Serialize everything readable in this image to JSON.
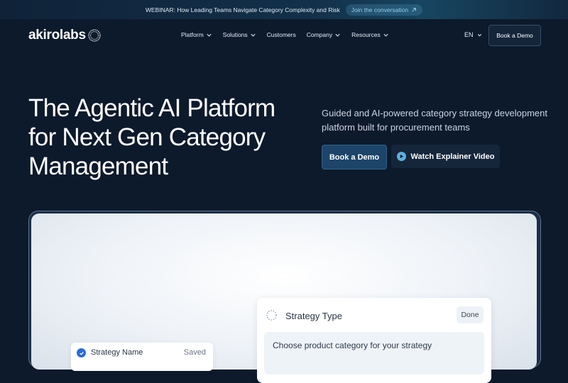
{
  "banner": {
    "text": "WEBINAR: How Leading Teams Navigate Category Complexity and Risk",
    "cta": "Join the conversation"
  },
  "nav": {
    "logo": "akirolabs",
    "items": [
      {
        "label": "Platform",
        "has_dropdown": true
      },
      {
        "label": "Solutions",
        "has_dropdown": true
      },
      {
        "label": "Customers",
        "has_dropdown": false
      },
      {
        "label": "Company",
        "has_dropdown": true
      },
      {
        "label": "Resources",
        "has_dropdown": true
      }
    ],
    "language": "EN",
    "demo_button": "Book a Demo"
  },
  "hero": {
    "title": "The Agentic AI Platform for Next Gen Category Management",
    "subtitle": "Guided and AI-powered category strategy development platform built for procurement teams",
    "primary_button": "Book a Demo",
    "secondary_button": "Watch Explainer Video"
  },
  "preview": {
    "strategy_card": {
      "title": "Strategy Type",
      "done_label": "Done",
      "prompt": "Choose product category for your strategy"
    },
    "name_card": {
      "label": "Strategy Name",
      "status": "Saved"
    }
  },
  "colors": {
    "background": "#0d1a2c",
    "accent": "#5fb0e0",
    "check": "#2b6bd6"
  }
}
